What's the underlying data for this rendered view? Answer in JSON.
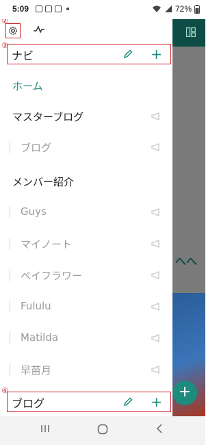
{
  "status_bar": {
    "time": "5:09",
    "battery": "72%"
  },
  "annotations": {
    "settings": "②",
    "nav_section": "③",
    "blog_section": "④"
  },
  "sections": {
    "nav": {
      "label": "ナビ"
    },
    "blog": {
      "label": "ブログ"
    }
  },
  "nav_items": [
    {
      "label": "ホーム",
      "kind": "home"
    },
    {
      "label": "マスターブログ",
      "kind": "top"
    },
    {
      "label": "ブログ",
      "kind": "sub"
    },
    {
      "label": "メンバー紹介",
      "kind": "top"
    },
    {
      "label": "Guys",
      "kind": "sub"
    },
    {
      "label": "マイノート",
      "kind": "sub"
    },
    {
      "label": "ペイフラワー",
      "kind": "sub"
    },
    {
      "label": "Fululu",
      "kind": "sub"
    },
    {
      "label": "Matilda",
      "kind": "sub"
    },
    {
      "label": "早苗月",
      "kind": "sub"
    }
  ],
  "background": {
    "partial_text": "へへ"
  },
  "colors": {
    "accent": "#1d8b7d",
    "annotation": "#d0212b",
    "app_header": "#0e4d45"
  }
}
